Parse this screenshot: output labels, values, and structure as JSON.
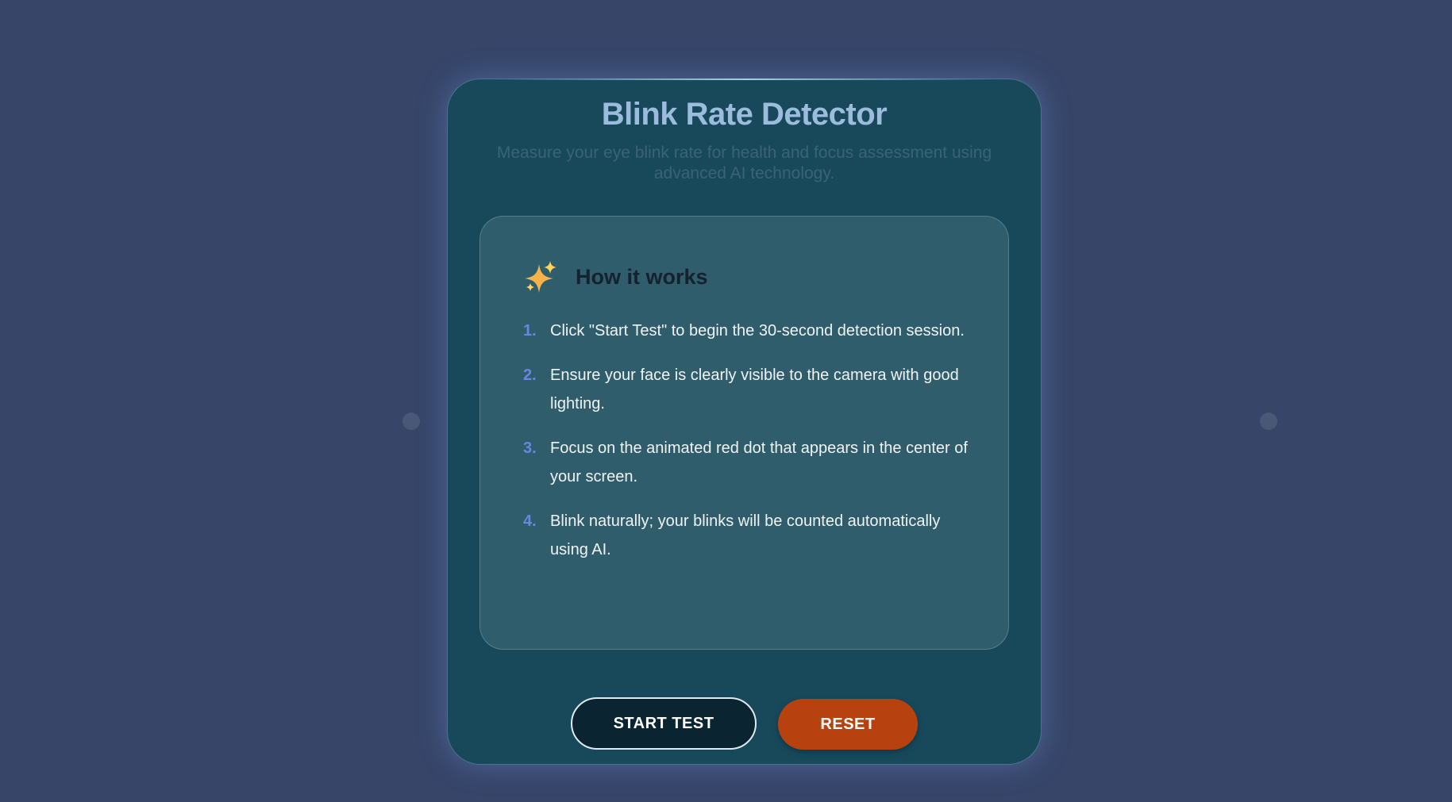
{
  "app": {
    "title": "Blink Rate Detector",
    "subtitle": "Measure your eye blink rate for health and focus assessment using advanced AI technology."
  },
  "how_it_works": {
    "icon": "sparkle-icon",
    "title": "How it works",
    "steps": [
      {
        "number": "1.",
        "text": "Click \"Start Test\" to begin the 30-second detection session."
      },
      {
        "number": "2.",
        "text": "Ensure your face is clearly visible to the camera with good lighting."
      },
      {
        "number": "3.",
        "text": "Focus on the animated red dot that appears in the center of your screen."
      },
      {
        "number": "4.",
        "text": "Blink naturally; your blinks will be counted automatically using AI."
      }
    ]
  },
  "actions": {
    "start_label": "START TEST",
    "reset_label": "RESET"
  },
  "colors": {
    "background": "#364568",
    "card": "#18495b",
    "info_box": "#305d6c",
    "title": "#9bbcdc",
    "step_number": "#6a86e0",
    "start_button": "#0b2431",
    "reset_button": "#b8420f"
  }
}
